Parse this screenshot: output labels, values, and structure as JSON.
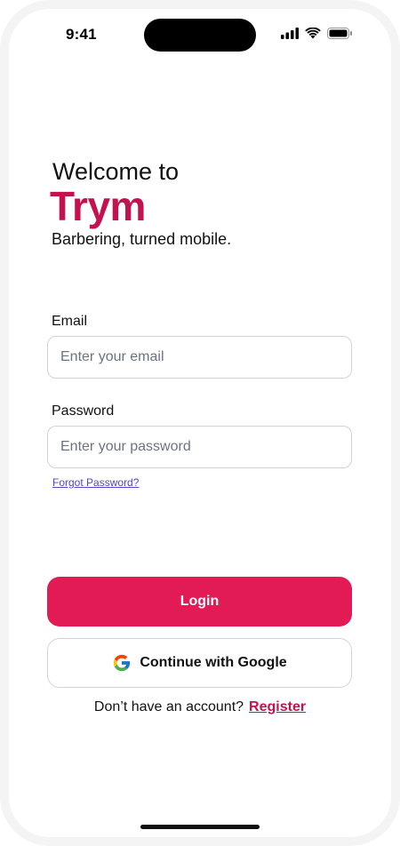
{
  "status_bar": {
    "time": "9:41",
    "icons": [
      "signal-icon",
      "wifi-icon",
      "battery-icon"
    ]
  },
  "header": {
    "welcome": "Welcome to",
    "brand": "Trym",
    "tagline": "Barbering, turned mobile."
  },
  "form": {
    "email_label": "Email",
    "email_placeholder": "Enter your email",
    "password_label": "Password",
    "password_placeholder": "Enter your password",
    "forgot_password": "Forgot Password?"
  },
  "actions": {
    "login_label": "Login",
    "google_label": "Continue with Google",
    "no_account_text": "Don’t have an account?",
    "register_label": "Register"
  },
  "colors": {
    "brand": "#c4124e",
    "primary_button": "#e31b54",
    "link": "#4f46c8"
  }
}
